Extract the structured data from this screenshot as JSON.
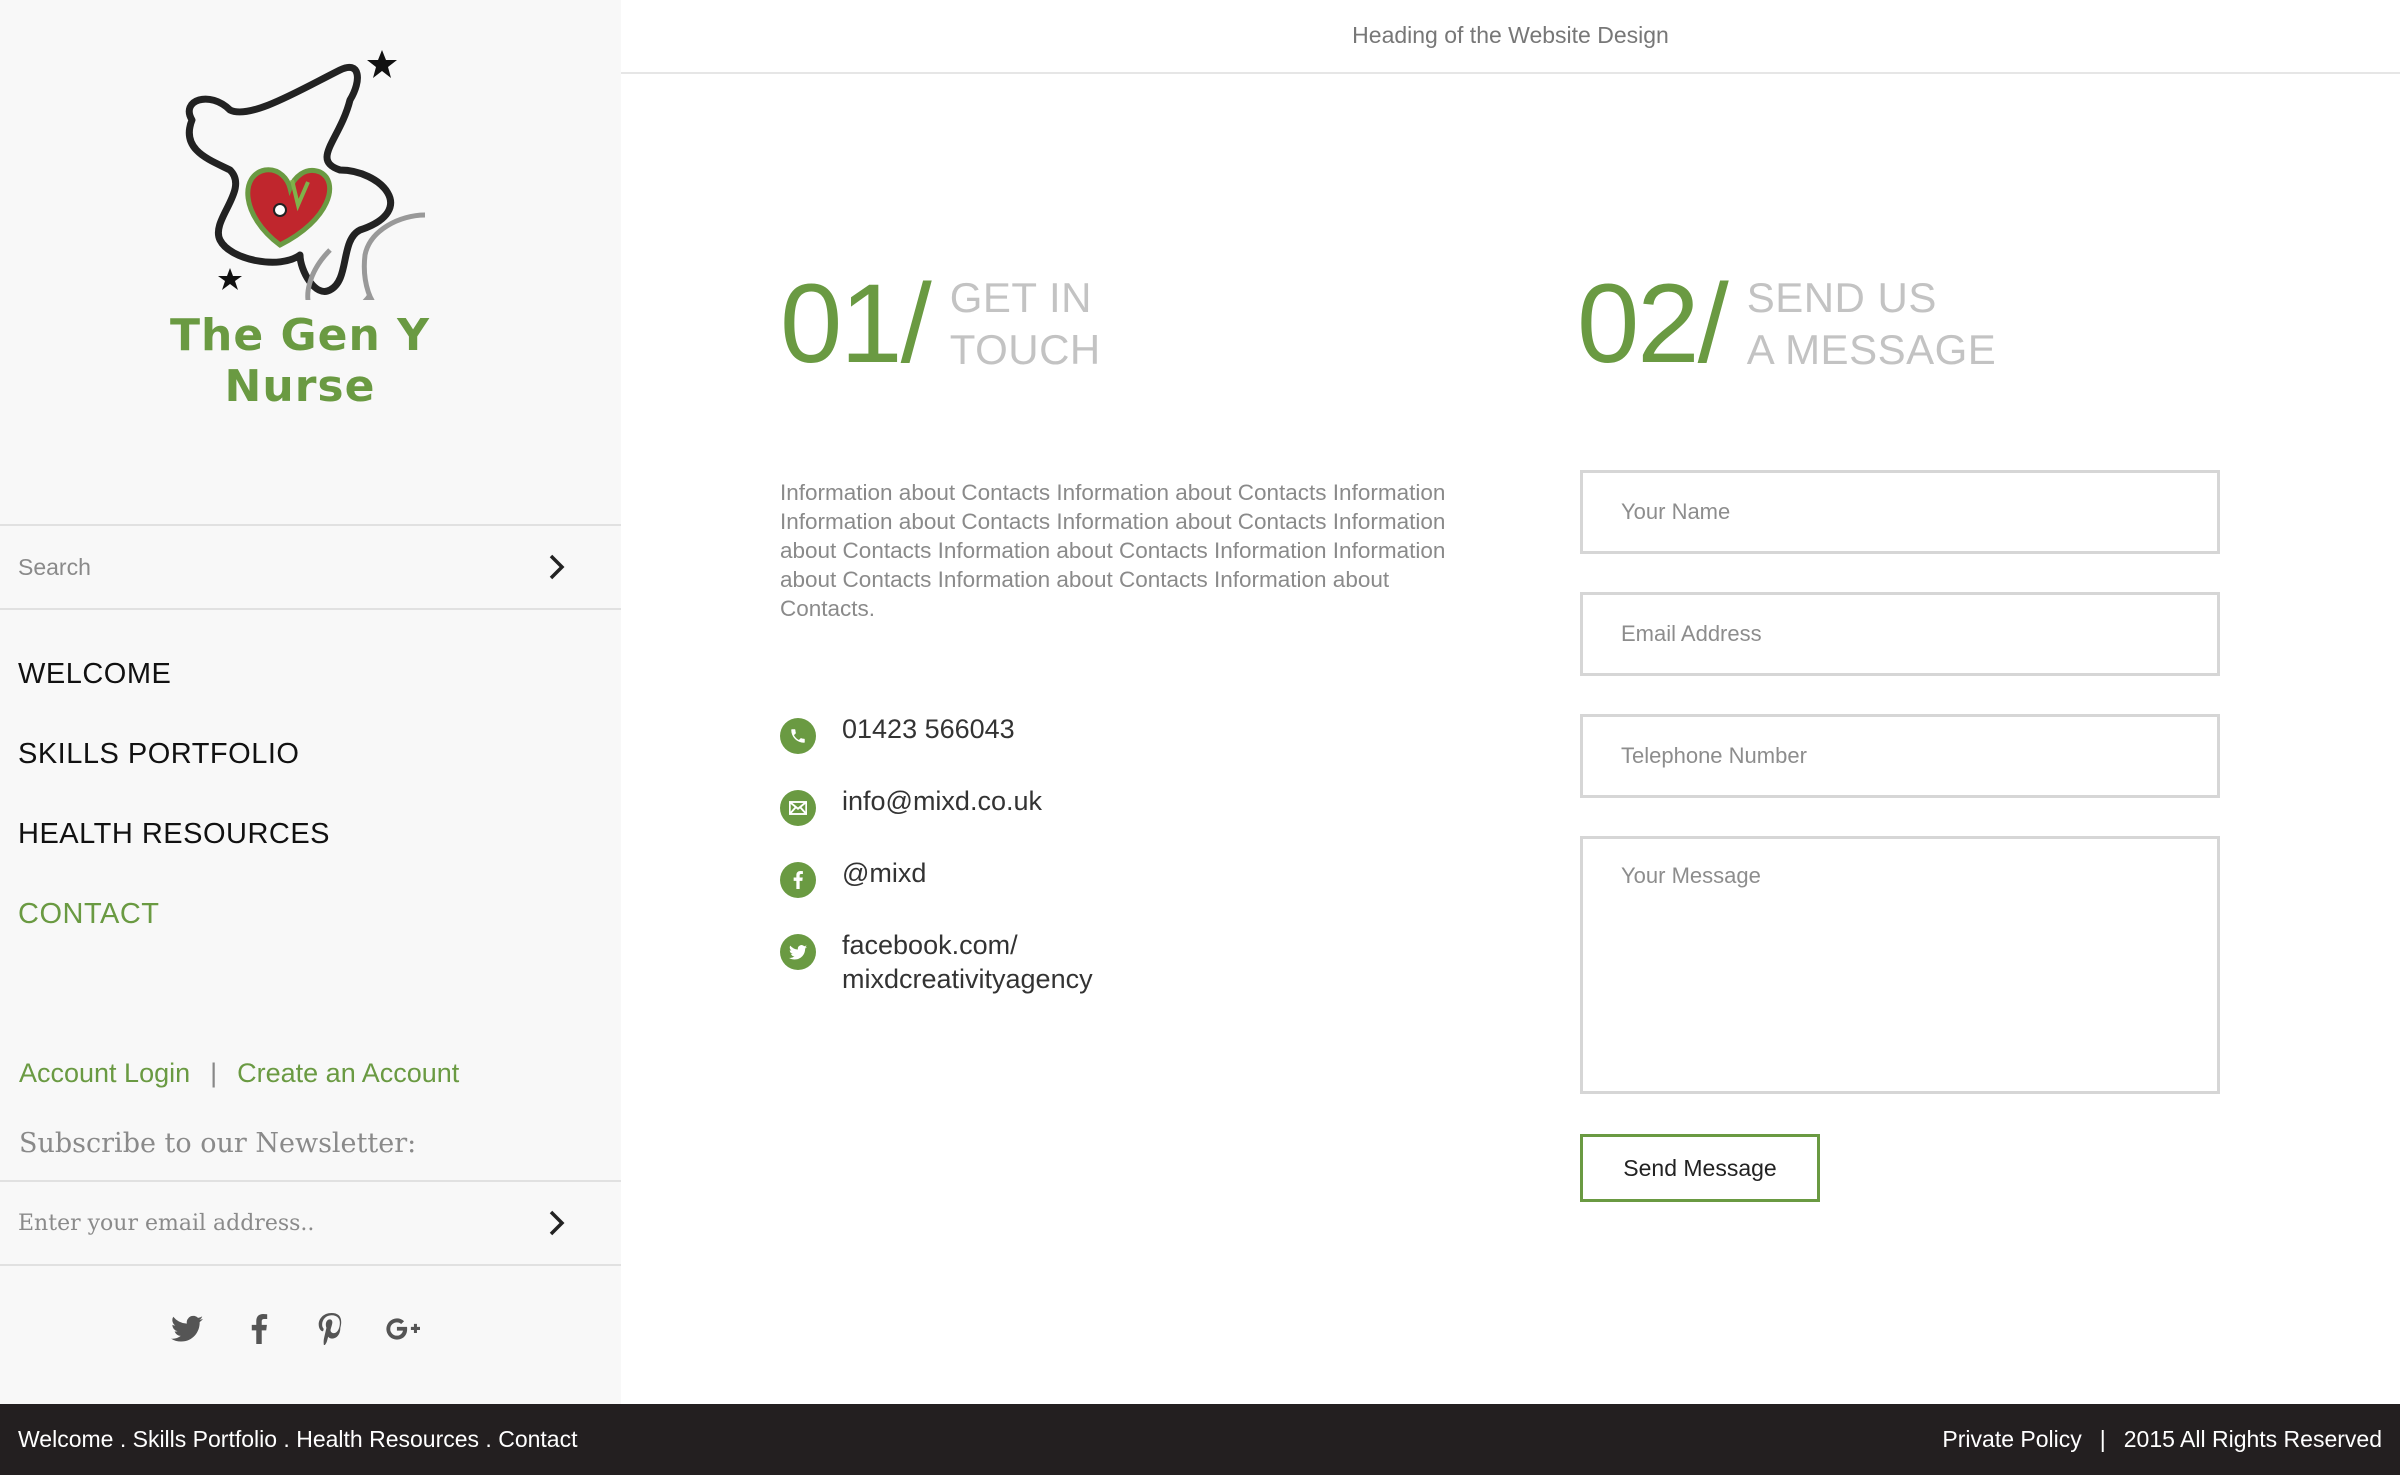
{
  "header": {
    "title": "Heading of the Website Design"
  },
  "logo": {
    "text": "The Gen Y Nurse"
  },
  "search": {
    "placeholder": "Search"
  },
  "nav": {
    "items": [
      {
        "label": "WELCOME"
      },
      {
        "label": "SKILLS PORTFOLIO"
      },
      {
        "label": "HEALTH RESOURCES"
      },
      {
        "label": "CONTACT",
        "active": true
      }
    ]
  },
  "account": {
    "login": "Account Login",
    "separator": "|",
    "create": "Create an Account"
  },
  "newsletter": {
    "label": "Subscribe to our Newsletter:",
    "placeholder": "Enter your email address.."
  },
  "social_icons": [
    "twitter-icon",
    "facebook-icon",
    "pinterest-icon",
    "google-plus-icon"
  ],
  "section1": {
    "number": "01/",
    "title_line1": "GET IN",
    "title_line2": "TOUCH",
    "info": "Information about Contacts Information about Contacts Information Information about Contacts Information about Contacts Information about Contacts Information about Contacts Information Information about Contacts Information about Contacts Information about Contacts.",
    "contacts": [
      {
        "icon": "phone-icon",
        "text": "01423 566043"
      },
      {
        "icon": "mail-icon",
        "text": "info@mixd.co.uk"
      },
      {
        "icon": "facebook-icon",
        "text": "@mixd"
      },
      {
        "icon": "twitter-icon",
        "text_line1": "facebook.com/",
        "text_line2": "mixdcreativityagency"
      }
    ]
  },
  "section2": {
    "number": "02/",
    "title_line1": "SEND US",
    "title_line2": "A MESSAGE",
    "fields": {
      "name": "Your Name",
      "email": "Email Address",
      "phone": "Telephone Number",
      "message": "Your Message"
    },
    "submit": "Send Message"
  },
  "footer": {
    "links": [
      "Welcome",
      "Skills Portfolio",
      "Health Resources",
      "Contact"
    ],
    "link_sep": " . ",
    "privacy": "Private Policy",
    "sep": "|",
    "rights": "2015 All Rights Reserved"
  },
  "colors": {
    "accent": "#6a9a42",
    "footer_bg": "#231f20",
    "sidebar_bg": "#f8f8f8"
  }
}
